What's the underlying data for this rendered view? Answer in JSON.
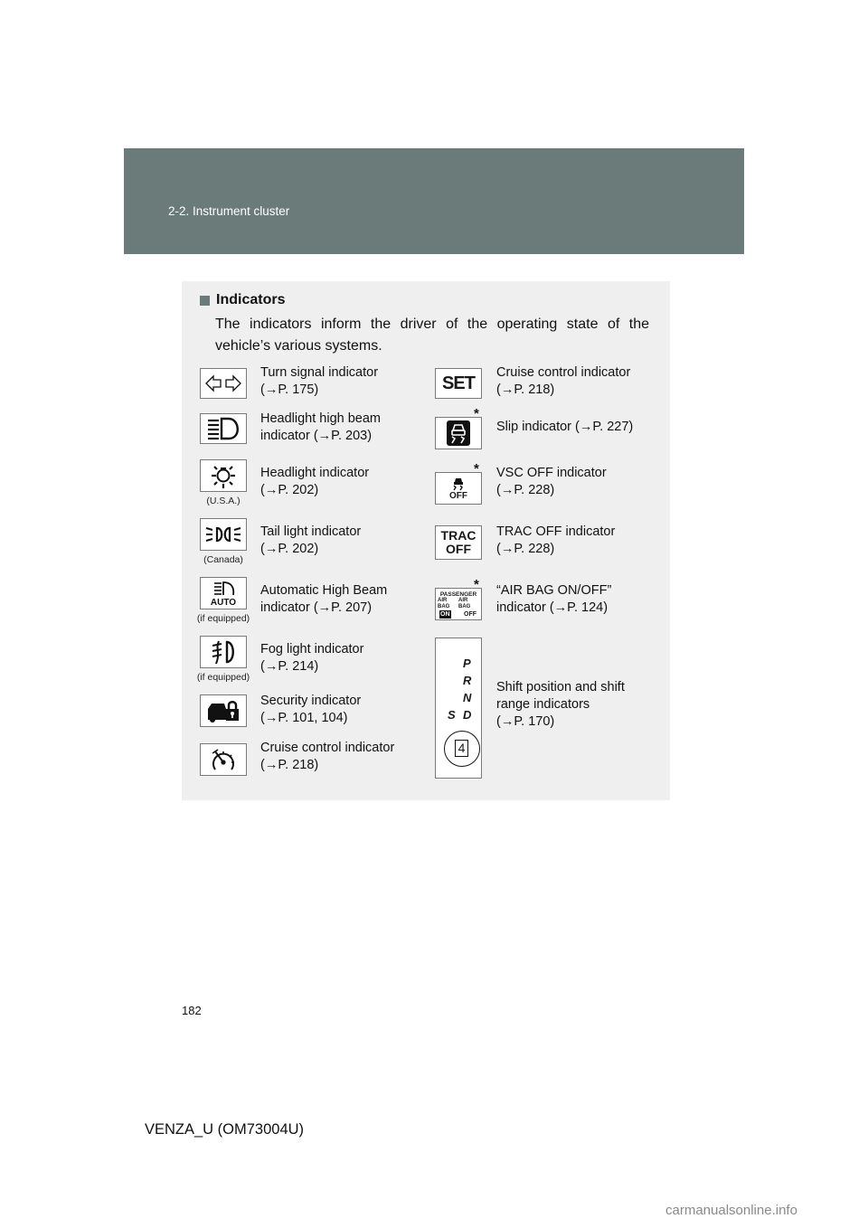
{
  "header": {
    "section": "2-2. Instrument cluster"
  },
  "panel": {
    "heading": "Indicators",
    "intro": "The indicators inform the driver of the operating state of the vehicle’s various systems.",
    "left_items": [
      {
        "icon": "turn-signal-icon",
        "line1": "Turn signal indicator",
        "line2": "(→P. 175)",
        "note": ""
      },
      {
        "icon": "headlight-high-beam-icon",
        "line1": "Headlight high beam",
        "line2": "indicator (→P. 203)",
        "note": ""
      },
      {
        "icon": "headlight-icon",
        "line1": "Headlight indicator",
        "line2": "(→P. 202)",
        "note": "(U.S.A.)"
      },
      {
        "icon": "tail-light-icon",
        "line1": "Tail light indicator",
        "line2": "(→P. 202)",
        "note": "(Canada)"
      },
      {
        "icon": "auto-high-beam-icon",
        "line1": "Automatic High Beam",
        "line2": "indicator (→P. 207)",
        "note": "(if equipped)"
      },
      {
        "icon": "fog-light-icon",
        "line1": "Fog light indicator",
        "line2": "(→P. 214)",
        "note": "(if equipped)"
      },
      {
        "icon": "security-icon",
        "line1": "Security indicator",
        "line2": "(→P. 101, 104)",
        "note": ""
      },
      {
        "icon": "cruise-control-speedometer-icon",
        "line1": "Cruise control indicator",
        "line2": "(→P. 218)",
        "note": ""
      }
    ],
    "right_items": [
      {
        "icon": "set-icon",
        "icon_text": "SET",
        "line1": "Cruise control indicator",
        "line2": "(→P. 218)",
        "asterisk": ""
      },
      {
        "icon": "slip-icon",
        "line1": "Slip indicator (→P. 227)",
        "line2": "",
        "asterisk": "*"
      },
      {
        "icon": "vsc-off-icon",
        "icon_text": "OFF",
        "line1": "VSC OFF indicator",
        "line2": "(→P. 228)",
        "asterisk": "*"
      },
      {
        "icon": "trac-off-icon",
        "icon_text": "TRAC",
        "icon_text2": "OFF",
        "line1": "TRAC OFF indicator",
        "line2": "(→P. 228)",
        "asterisk": ""
      },
      {
        "icon": "airbag-on-off-icon",
        "icon_text": "PASSENGER",
        "icon_text2": "AIR BAG",
        "icon_text3": "AIR BAG",
        "icon_on": "ON",
        "icon_off": "OFF",
        "line1": "“AIR BAG ON/OFF”",
        "line2": "indicator (→P. 124)",
        "asterisk": "*"
      },
      {
        "icon": "shift-position-icon",
        "gears": [
          "P",
          "R",
          "N",
          "S",
          "D"
        ],
        "range": "4",
        "line1": "Shift position and shift",
        "line2": "range indicators",
        "line3": "(→P. 170)",
        "asterisk": ""
      }
    ]
  },
  "footer": {
    "page_number": "182",
    "manual_id": "VENZA_U (OM73004U)",
    "watermark": "carmanualsonline.info"
  }
}
